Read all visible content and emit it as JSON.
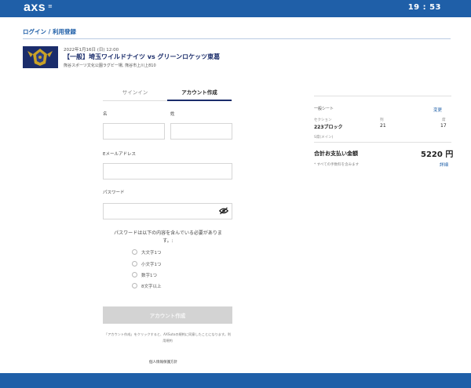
{
  "header": {
    "logo_text": "axs",
    "logo_mark": "≡",
    "clock": "19 : 53",
    "brand_color": "#1f5fa8"
  },
  "page": {
    "heading": "ログイン / 利用登録"
  },
  "event": {
    "date": "2022年1月16日 (日) 12:00",
    "title": "【一般】埼玉ワイルドナイツ vs グリーンロケッツ東葛",
    "venue": "熊谷スポーツ文化公園ラグビー場, 熊谷市上川上810"
  },
  "tabs": [
    {
      "label": "サインイン",
      "active": false
    },
    {
      "label": "アカウント作成",
      "active": true
    }
  ],
  "form": {
    "first_name_label": "名",
    "last_name_label": "姓",
    "email_label": "Eメールアドレス",
    "password_label": "パスワード",
    "first_name_value": "",
    "last_name_value": "",
    "email_value": "",
    "password_value": "",
    "password_note": "パスワードは以下の内容を含んでいる必要があります。:",
    "requirements": [
      "大文字1つ",
      "小文字1つ",
      "数字1つ",
      "8文字以上"
    ],
    "submit_label": "アカウント作成",
    "terms_text": "「アカウント作成」をクリックすると、AXSutoの規約に同意したことになります。利用規約",
    "privacy_link": "個人情報保護方針"
  },
  "summary": {
    "ticket_type": "一般シート",
    "change_link": "変更",
    "section_label": "セクション",
    "row_label": "列",
    "seat_label": "席",
    "section_value": "223ブロック",
    "row_value": "21",
    "seat_value": "17",
    "type_note": "S席(メイン)",
    "total_label": "合計お支払い金額",
    "total_amount": "5220 円",
    "fee_note": "* すべての手数料を含みます",
    "details_link": "詳細"
  }
}
